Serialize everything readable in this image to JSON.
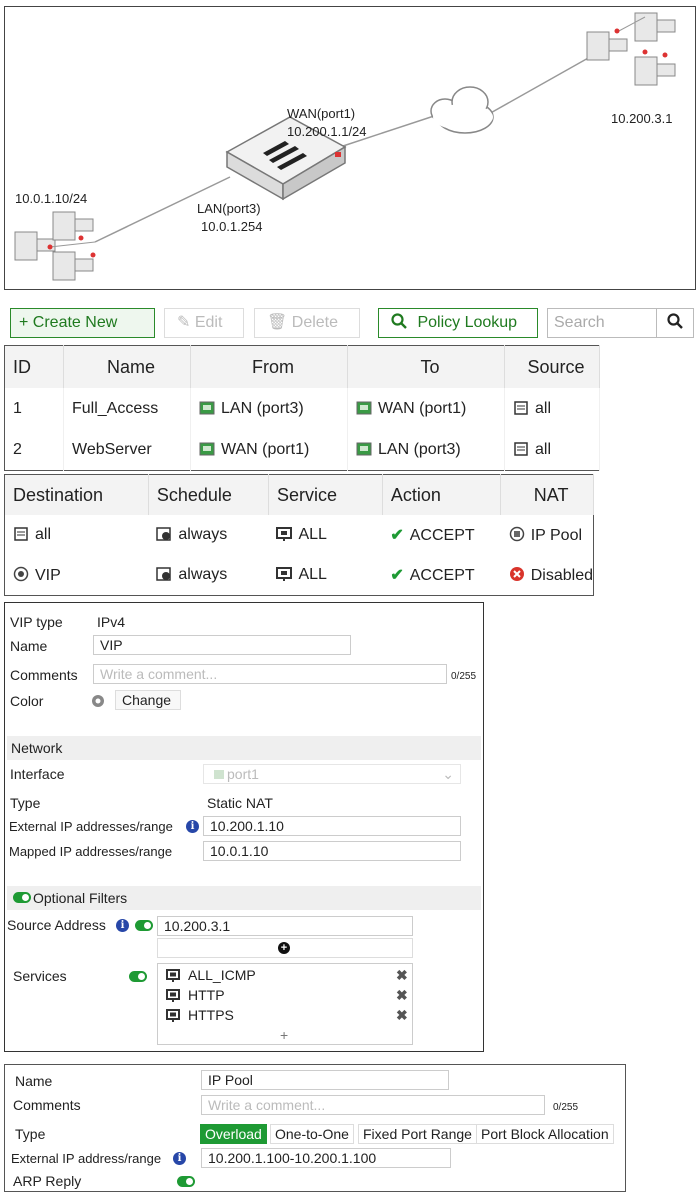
{
  "diagram": {
    "wan_port": "WAN(port1)",
    "wan_ip": "10.200.1.1/24",
    "lan_port": "LAN(port3)",
    "lan_ip": "10.0.1.254",
    "left_net": "10.0.1.10/24",
    "right_host": "10.200.3.1"
  },
  "toolbar": {
    "create_new": "+ Create New",
    "edit": "Edit",
    "delete": "Delete",
    "policy_lookup": "Policy Lookup",
    "search_placeholder": "Search"
  },
  "policy_table_1": {
    "headers": [
      "ID",
      "Name",
      "From",
      "To",
      "Source"
    ],
    "rows": [
      [
        "1",
        "Full_Access",
        "LAN (port3)",
        "WAN (port1)",
        "all"
      ],
      [
        "2",
        "WebServer",
        "WAN (port1)",
        "LAN (port3)",
        "all"
      ]
    ]
  },
  "policy_table_2": {
    "headers": [
      "Destination",
      "Schedule",
      "Service",
      "Action",
      "NAT"
    ],
    "rows": [
      [
        "all",
        "always",
        "ALL",
        "ACCEPT",
        "IP Pool"
      ],
      [
        "VIP",
        "always",
        "ALL",
        "ACCEPT",
        "Disabled"
      ]
    ]
  },
  "vip_form": {
    "vip_type_label": "VIP type",
    "vip_type_value": "IPv4",
    "name_label": "Name",
    "name_value": "VIP",
    "comments_label": "Comments",
    "comments_placeholder": "Write a comment...",
    "comments_count": "0/255",
    "color_label": "Color",
    "color_button": "Change",
    "network_section": "Network",
    "interface_label": "Interface",
    "interface_value": "port1",
    "type_label": "Type",
    "type_value": "Static NAT",
    "external_label": "External IP addresses/range",
    "external_value": "10.200.1.10",
    "mapped_label": "Mapped IP addresses/range",
    "mapped_value": "10.0.1.10",
    "optional_filters": "Optional Filters",
    "source_address_label": "Source Address",
    "source_address_value": "10.200.3.1",
    "services_label": "Services",
    "services": [
      "ALL_ICMP",
      "HTTP",
      "HTTPS"
    ],
    "add_symbol": "+"
  },
  "ippool_form": {
    "name_label": "Name",
    "name_value": "IP Pool",
    "comments_label": "Comments",
    "comments_placeholder": "Write a comment...",
    "comments_count": "0/255",
    "type_label": "Type",
    "type_options": [
      "Overload",
      "One-to-One",
      "Fixed Port Range",
      "Port Block Allocation"
    ],
    "external_label": "External IP address/range",
    "external_value": "10.200.1.100-10.200.1.100",
    "arp_reply_label": "ARP Reply"
  },
  "colors": {
    "accent_green": "#1e9a34",
    "info_blue": "#2747a8",
    "disabled_red": "#d9342b"
  }
}
